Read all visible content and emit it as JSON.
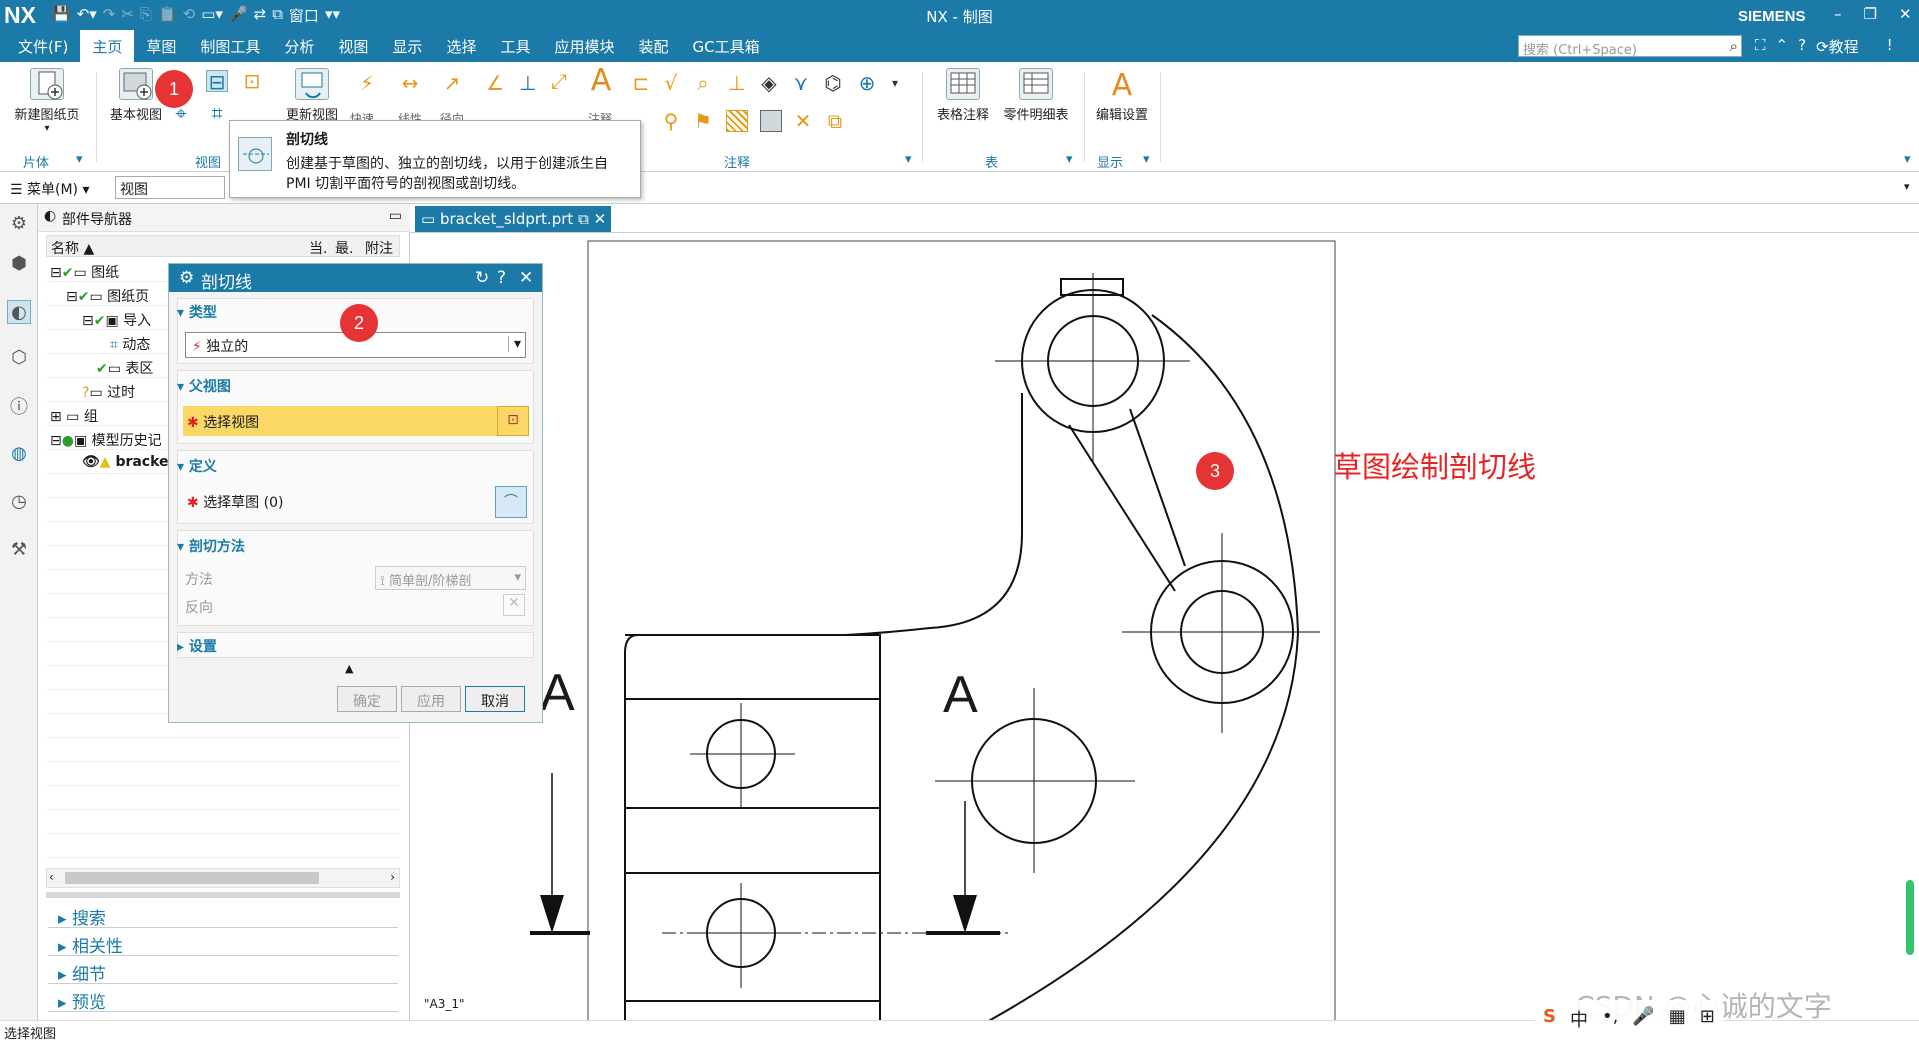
{
  "titlebar": {
    "logo": "NX",
    "title": "NX - 制图",
    "brand": "SIEMENS",
    "window_menu": "窗口"
  },
  "menubar": {
    "items": [
      "文件(F)",
      "主页",
      "草图",
      "制图工具",
      "分析",
      "视图",
      "显示",
      "选择",
      "工具",
      "应用模块",
      "装配",
      "GC工具箱"
    ],
    "active": "主页",
    "search_placeholder": "搜索 (Ctrl+Space)",
    "tutorial": "教程"
  },
  "ribbon": {
    "new_sheet": "新建图纸页",
    "base_view": "基本视图",
    "update_view": "更新视图",
    "table_note": "表格注释",
    "parts_list": "零件明细表",
    "edit_settings": "编辑设置",
    "groups": {
      "sheet": "片体",
      "view": "视图",
      "annotation": "注释",
      "table": "表",
      "display": "显示"
    },
    "partial_labels": [
      "快速",
      "线性",
      "径向",
      "注释"
    ]
  },
  "filterbar": {
    "menu": "菜单(M)",
    "filter_value": "视图"
  },
  "tooltip": {
    "title": "剖切线",
    "line1": "创建基于草图的、独立的剖切线，以用于创建派生自",
    "line2": "PMI 切割平面符号的剖视图或剖切线。"
  },
  "navigator": {
    "title": "部件导航器",
    "columns": [
      "名称",
      "当.",
      "最.",
      "附注"
    ],
    "tree": [
      "图纸",
      "图纸页",
      "导入",
      "动态",
      "表区",
      "过时",
      "组",
      "模型历史记",
      "bracke"
    ]
  },
  "bottom_panels": [
    "搜索",
    "相关性",
    "细节",
    "预览"
  ],
  "dialog": {
    "title": "剖切线",
    "sections": {
      "type": "类型",
      "parent_view": "父视图",
      "definition": "定义",
      "section_method": "剖切方法",
      "settings": "设置"
    },
    "type_value": "独立的",
    "select_view": "选择视图",
    "select_sketch": "选择草图 (0)",
    "method_label": "方法",
    "method_value": "简单剖/阶梯剖",
    "reverse_label": "反向",
    "buttons": {
      "ok": "确定",
      "apply": "应用",
      "cancel": "取消"
    }
  },
  "canvas": {
    "tab": "bracket_sldprt.prt",
    "sheet_label": "\"A3_1\"",
    "section_letter_left": "A",
    "section_letter_right": "A"
  },
  "annotation": {
    "note": "草图绘制剖切线",
    "badge1": "1",
    "badge2": "2",
    "badge3": "3"
  },
  "status": {
    "text": "选择视图"
  },
  "watermark": "CSDN @心诚的文字",
  "ime": [
    "中",
    "•,",
    "🎤",
    "▦",
    "⊞"
  ],
  "colors": {
    "accent": "#1b7aa8",
    "highlight": "#fbd866",
    "badge": "#e63333",
    "note": "#e82323"
  }
}
